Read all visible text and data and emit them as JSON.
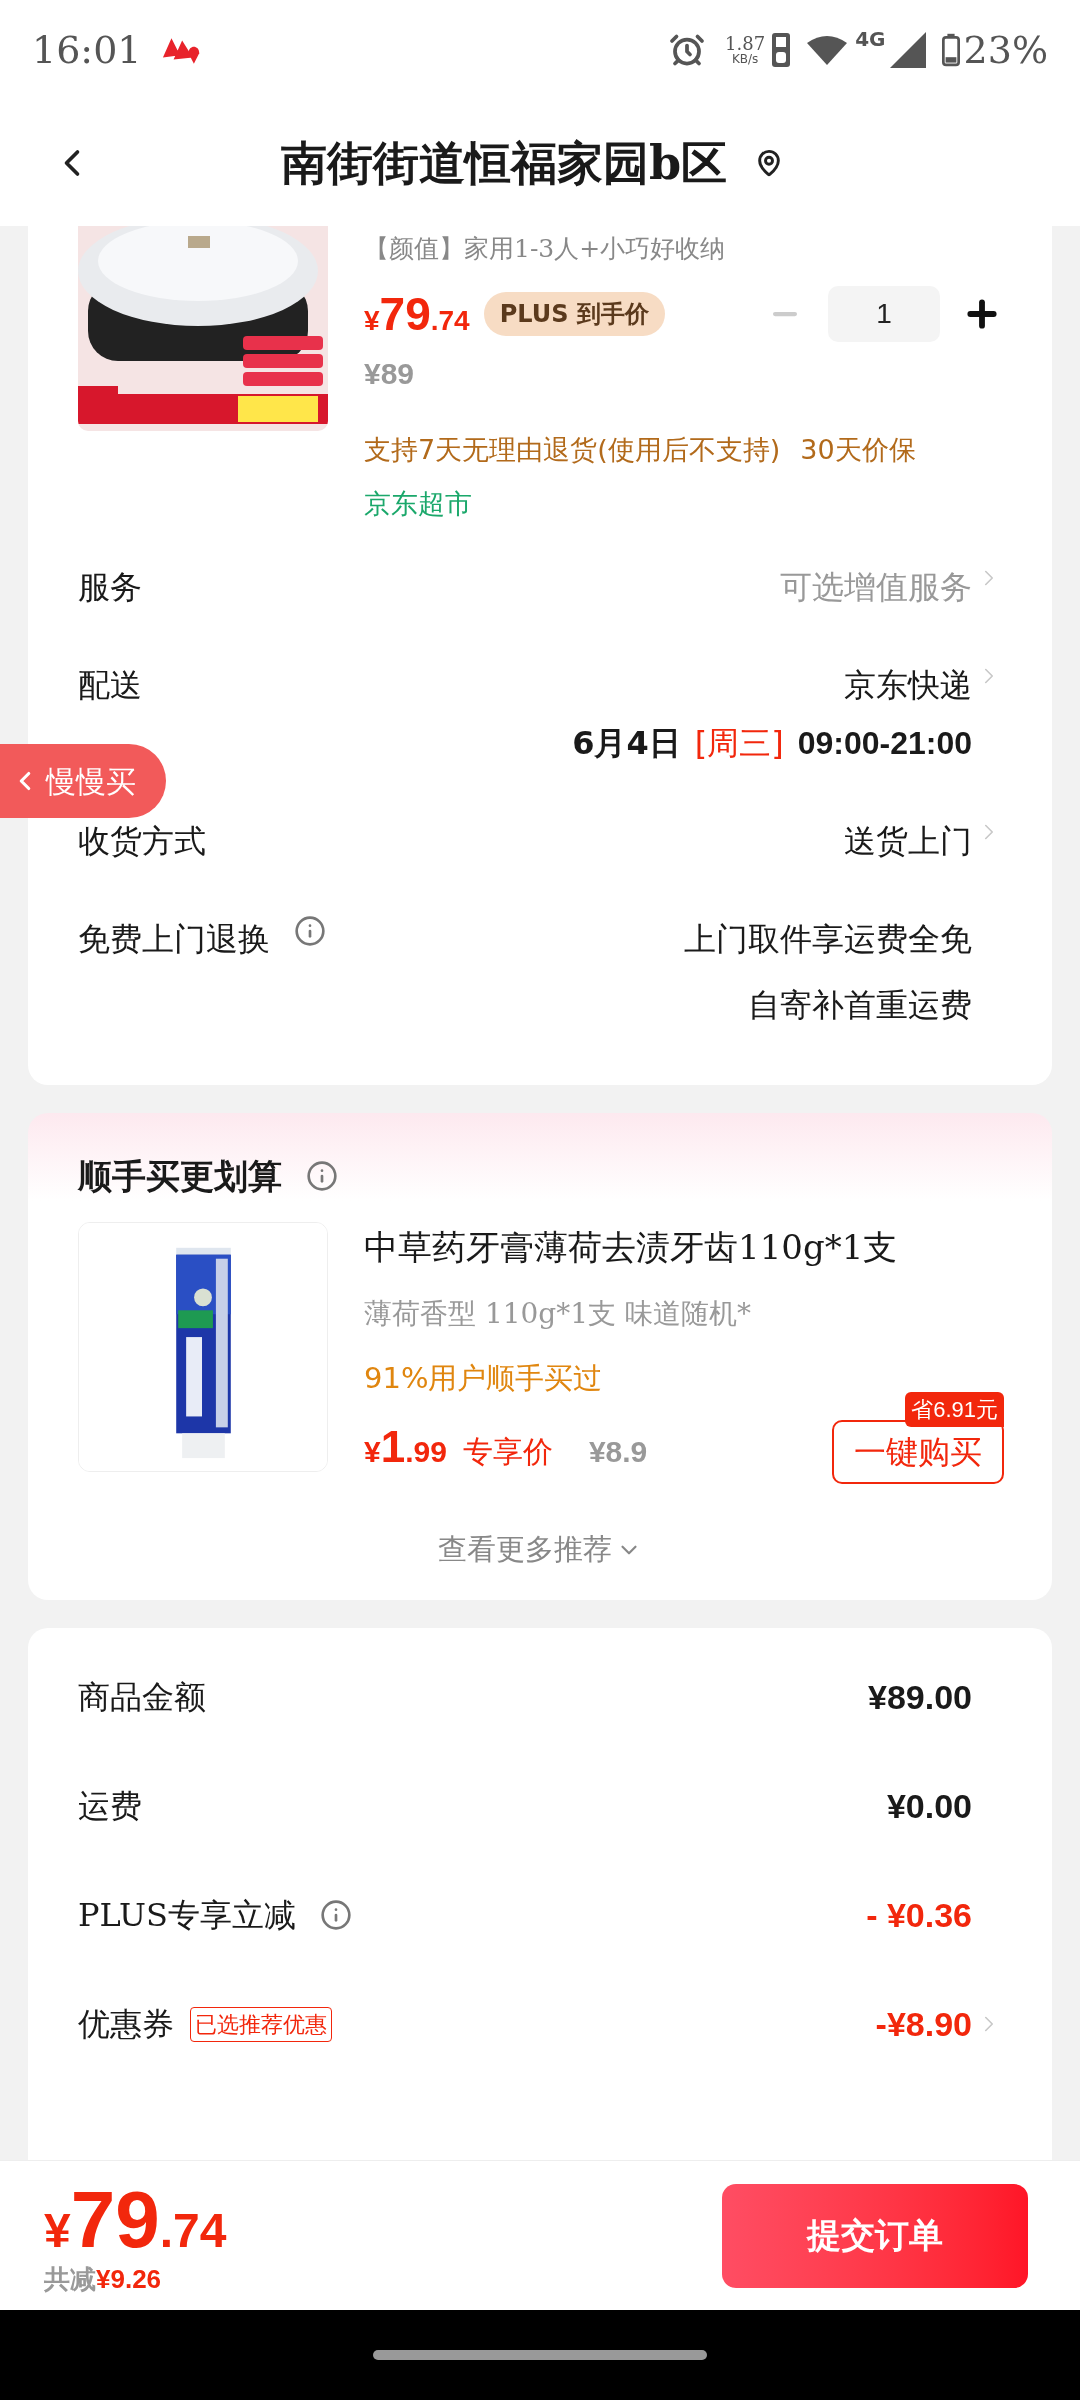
{
  "status_bar": {
    "time": "16:01",
    "net_speed": "1.87",
    "net_unit": "KB/s",
    "network": "4G",
    "battery": "23%"
  },
  "header": {
    "title": "南街街道恒福家园b区"
  },
  "order_item": {
    "title": "【颜值】家用1-3人+小巧好收纳",
    "price": {
      "currency": "¥",
      "integer": "79",
      "decimal": ".74"
    },
    "price_badge": "PLUS 到手价",
    "quantity": "1",
    "decrease_disabled": true,
    "original_price": "¥89",
    "policies": [
      "支持7天无理由退货(使用后不支持)",
      "30天价保"
    ],
    "store": "京东超市"
  },
  "details": [
    {
      "label": "服务",
      "info": false,
      "value": "可选增值服务",
      "muted": true,
      "arrow": true
    },
    {
      "label": "配送",
      "info": false,
      "value": "京东快递",
      "muted": false,
      "arrow": true,
      "schedule": {
        "date": "6月4日",
        "weekday": "[周三]",
        "time": "09:00-21:00"
      }
    },
    {
      "label": "收货方式",
      "info": false,
      "value": "送货上门",
      "muted": false,
      "arrow": true
    },
    {
      "label": "免费上门退换",
      "info": true,
      "value": "上门取件享运费全免",
      "muted": false,
      "arrow": false,
      "extra_lines": [
        "自寄补首重运费"
      ]
    }
  ],
  "floating_button": "慢慢买",
  "recommend": {
    "title": "顺手买更划算",
    "product": {
      "name": "中草药牙膏薄荷去渍牙齿110g*1支",
      "spec": "薄荷香型 110g*1支 味道随机*",
      "social_proof": "91%用户顺手买过",
      "price": {
        "currency": "¥",
        "integer": "1",
        "decimal": ".99"
      },
      "price_label": "专享价",
      "original_price": "¥8.9",
      "save_badge": "省6.91元",
      "buy_button": "一键购买"
    },
    "more_link": "查看更多推荐"
  },
  "summary": [
    {
      "label": "商品金额",
      "info": false,
      "value": "¥89.00",
      "highlight": false,
      "arrow": false
    },
    {
      "label": "运费",
      "info": false,
      "value": "¥0.00",
      "highlight": false,
      "arrow": false
    },
    {
      "label": "PLUS专享立减",
      "info": true,
      "value": "- ¥0.36",
      "highlight": true,
      "arrow": false
    },
    {
      "label": "优惠券",
      "info": false,
      "tag": "已选推荐优惠",
      "value": "-¥8.90",
      "highlight": true,
      "arrow": true
    }
  ],
  "footer": {
    "total": {
      "currency": "¥",
      "integer": "79",
      "decimal": ".74"
    },
    "saved_label": "共减",
    "saved_amount": "¥9.26",
    "submit": "提交订单"
  }
}
